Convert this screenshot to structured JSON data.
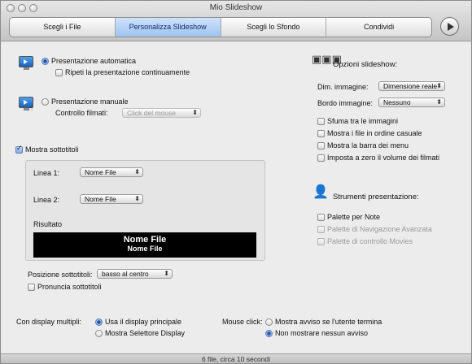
{
  "window": {
    "title": "Mio Slideshow"
  },
  "tabs": [
    "Scegli i File",
    "Personalizza Slideshow",
    "Scegli lo Sfondo",
    "Condividi"
  ],
  "presentation": {
    "auto_label": "Presentazione automatica",
    "repeat_label": "Ripeti la presentazione continuamente",
    "manual_label": "Presentazione manuale",
    "movie_control_label": "Controllo filmati:",
    "movie_control_value": "Click del mouse"
  },
  "subtitles": {
    "show_label": "Mostra sottotitoli",
    "line1_label": "Linea 1:",
    "line1_value": "Nome File",
    "line2_label": "Linea 2:",
    "line2_value": "Nome File",
    "result_label": "Risultato",
    "result_line1": "Nome File",
    "result_line2": "Nome File",
    "position_label": "Posizione sottotitoli:",
    "position_value": "basso al centro",
    "pronounce_label": "Pronuncia sottotitoli"
  },
  "options": {
    "title": "Opzioni slideshow:",
    "image_size_label": "Dim. immagine:",
    "image_size_value": "Dimensione reale",
    "image_border_label": "Bordo immagine:",
    "image_border_value": "Nessuno",
    "checks": [
      "Sfuma tra le immagini",
      "Mostra i file in ordine casuale",
      "Mostra la barra dei menu",
      "Imposta a zero il volume dei filmati"
    ]
  },
  "tools": {
    "title": "Strumenti presentazione:",
    "items": [
      "Palette per Note",
      "Palette di Navigazione Avanzata",
      "Palette di controllo Movies"
    ]
  },
  "displays": {
    "label": "Con display multipli:",
    "opt1": "Usa il display principale",
    "opt2": "Mostra Selettore Display"
  },
  "mouse": {
    "label": "Mouse click:",
    "opt1": "Mostra avviso se l'utente termina",
    "opt2": "Non mostrare nessun avviso"
  },
  "status": {
    "text": "6 file, circa 10 secondi"
  }
}
